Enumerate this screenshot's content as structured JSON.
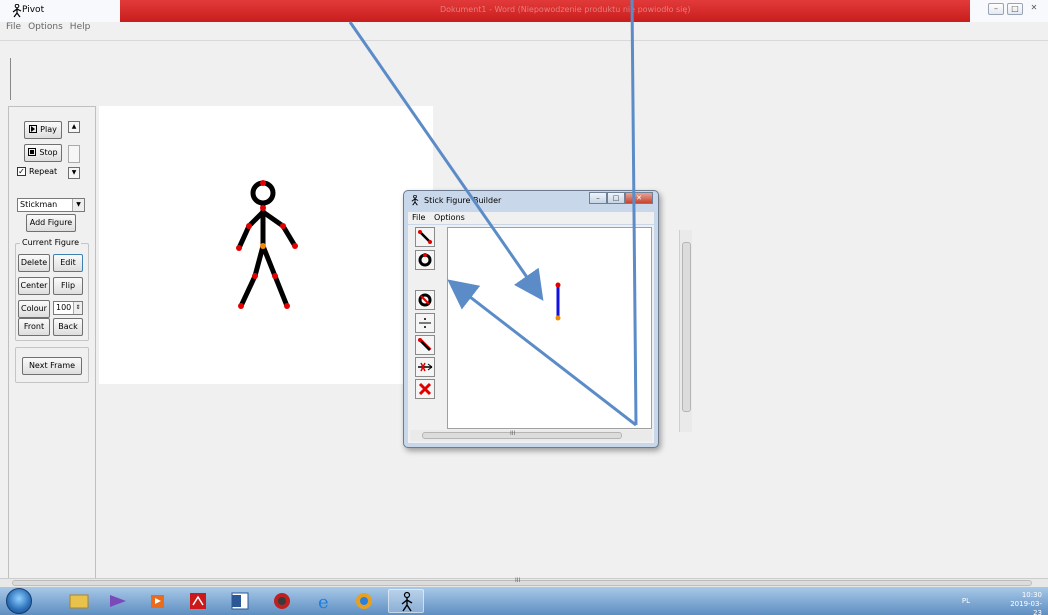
{
  "window": {
    "title": "Pivot",
    "menu": [
      "File",
      "Options",
      "Help"
    ],
    "buttons": {
      "minimize": "–",
      "restore": "□",
      "close": "✕"
    }
  },
  "title_overlay": "Dokument1 - Word (Niepowodzenie produktu nie powiodło się)",
  "left_panel": {
    "play_label": "Play",
    "stop_label": "Stop",
    "repeat_label": "Repeat",
    "repeat_checked": true,
    "figure_type": "Stickman",
    "add_figure_label": "Add Figure",
    "current_figure": {
      "title": "Current Figure",
      "delete_label": "Delete",
      "edit_label": "Edit",
      "center_label": "Center",
      "flip_label": "Flip",
      "colour_label": "Colour",
      "opacity_value": "100",
      "front_label": "Front",
      "back_label": "Back"
    },
    "next_frame_label": "Next Frame"
  },
  "builder": {
    "title": "Stick Figure Builder",
    "menu": [
      "File",
      "Options"
    ],
    "buttons": {
      "minimize": "–",
      "restore": "□",
      "close": "✕"
    },
    "tools": [
      "line-tool-icon",
      "circle-tool-icon",
      "no-circle-icon",
      "split-line-icon",
      "static-segment-icon",
      "shorten-line-icon",
      "delete-icon"
    ],
    "scroll_grip": "III"
  },
  "scrollbar": {
    "grip": "III"
  },
  "taskbar": {
    "apps": [
      "explorer",
      "visual-studio",
      "media-player",
      "acrobat",
      "word",
      "chrome-alt",
      "internet-explorer",
      "chrome",
      "pivot"
    ],
    "language": "PL",
    "time": "10:30",
    "date": "2019-03-23"
  },
  "colors": {
    "arrow": "#5b8cc8",
    "title_red": "#d42a2a",
    "joint_red": "#e00000",
    "joint_orange": "#f08a00",
    "segment_blue": "#1010e0"
  }
}
